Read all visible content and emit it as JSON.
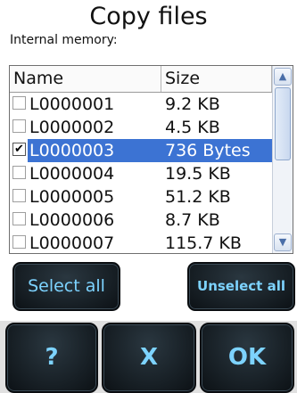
{
  "dialog": {
    "title": "Copy files",
    "subtitle": "Internal memory:"
  },
  "list": {
    "headers": {
      "name": "Name",
      "size": "Size"
    },
    "rows": [
      {
        "name": "L0000001",
        "size": "9.2 KB",
        "checked": false,
        "selected": false
      },
      {
        "name": "L0000002",
        "size": "4.5 KB",
        "checked": false,
        "selected": false
      },
      {
        "name": "L0000003",
        "size": "736 Bytes",
        "checked": true,
        "selected": true
      },
      {
        "name": "L0000004",
        "size": "19.5 KB",
        "checked": false,
        "selected": false
      },
      {
        "name": "L0000005",
        "size": "51.2 KB",
        "checked": false,
        "selected": false
      },
      {
        "name": "L0000006",
        "size": "8.7 KB",
        "checked": false,
        "selected": false
      },
      {
        "name": "L0000007",
        "size": "115.7 KB",
        "checked": false,
        "selected": false
      }
    ],
    "check_mark": "✔",
    "scroll_up_icon": "▲",
    "scroll_down_icon": "▼"
  },
  "buttons": {
    "select_all": "Select all",
    "unselect_all": "Unselect all",
    "help": "?",
    "cancel": "X",
    "ok": "OK"
  },
  "colors": {
    "selection": "#3c73d3",
    "button_text": "#7dd3ff",
    "button_bg": "#111820"
  }
}
